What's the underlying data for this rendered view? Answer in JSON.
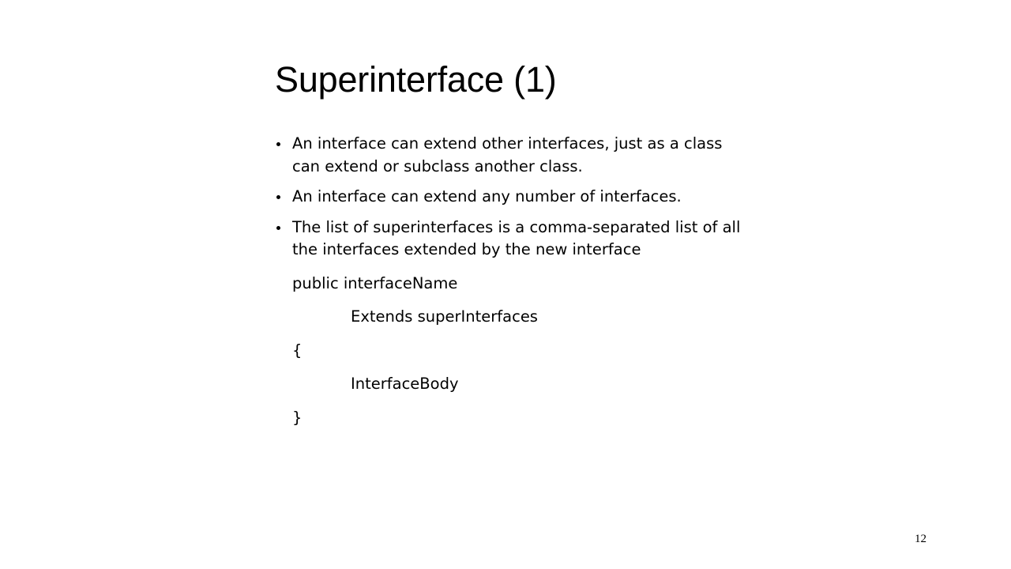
{
  "slide": {
    "title": "Superinterface (1)",
    "page_number": "12",
    "background_color": "#ffffff",
    "text_color": "#000000"
  },
  "bullets": [
    {
      "text": "An interface can extend other interfaces, just as a class can extend or subclass another class."
    },
    {
      "text": "An interface can extend any number of interfaces."
    },
    {
      "text": "The list of superinterfaces is a comma-separated list of all the interfaces extended by the new interface"
    }
  ],
  "code_block": {
    "lines": [
      {
        "text": "public interfaceName",
        "indent": false
      },
      {
        "text": "Extends superInterfaces",
        "indent": true
      },
      {
        "text": "{",
        "indent": false
      },
      {
        "text": "InterfaceBody",
        "indent": true
      },
      {
        "text": "}",
        "indent": false
      }
    ]
  }
}
